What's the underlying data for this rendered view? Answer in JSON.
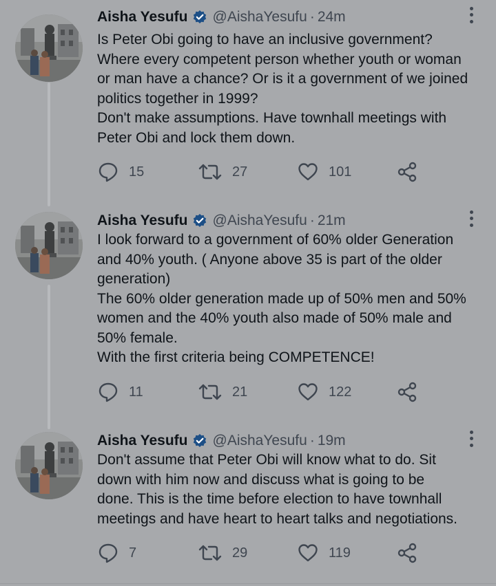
{
  "colors": {
    "background": "#a7a9ac",
    "text": "#0f1419",
    "secondary_text": "#3f4650",
    "verified_badge": "#1d4f86",
    "thread_line": "#b8babd"
  },
  "tweets": [
    {
      "author_name": "Aisha Yesufu",
      "handle": "@AishaYesufu",
      "separator": "·",
      "time": "24m",
      "verified_icon": "verified-badge-icon",
      "text_lines": [
        "Is Peter Obi going to have an inclusive government?",
        "Where every competent person whether youth or woman",
        "or man have a chance? Or is it a government of we joined",
        "politics together in 1999?",
        "Don't make assumptions. Have townhall meetings with",
        "Peter Obi and lock them down."
      ],
      "replies": "15",
      "retweets": "27",
      "likes": "101"
    },
    {
      "author_name": "Aisha Yesufu",
      "handle": "@AishaYesufu",
      "separator": "·",
      "time": "21m",
      "verified_icon": "verified-badge-icon",
      "text_lines": [
        "I look forward to a government of 60% older Generation",
        "and 40% youth. ( Anyone above 35 is part of the older",
        "generation)",
        "The 60% older generation made up of 50% men and 50%",
        "women and the 40% youth also made of 50% male and",
        "50% female.",
        "With the first criteria being COMPETENCE!"
      ],
      "replies": "11",
      "retweets": "21",
      "likes": "122"
    },
    {
      "author_name": "Aisha Yesufu",
      "handle": "@AishaYesufu",
      "separator": "·",
      "time": "19m",
      "verified_icon": "verified-badge-icon",
      "text_lines": [
        "Don't assume that Peter Obi will know what to do. Sit",
        "down with him now and discuss what is going to be",
        "done. This is the time before election to have townhall",
        "meetings and have heart to heart talks and negotiations."
      ],
      "replies": "7",
      "retweets": "29",
      "likes": "119"
    }
  ]
}
